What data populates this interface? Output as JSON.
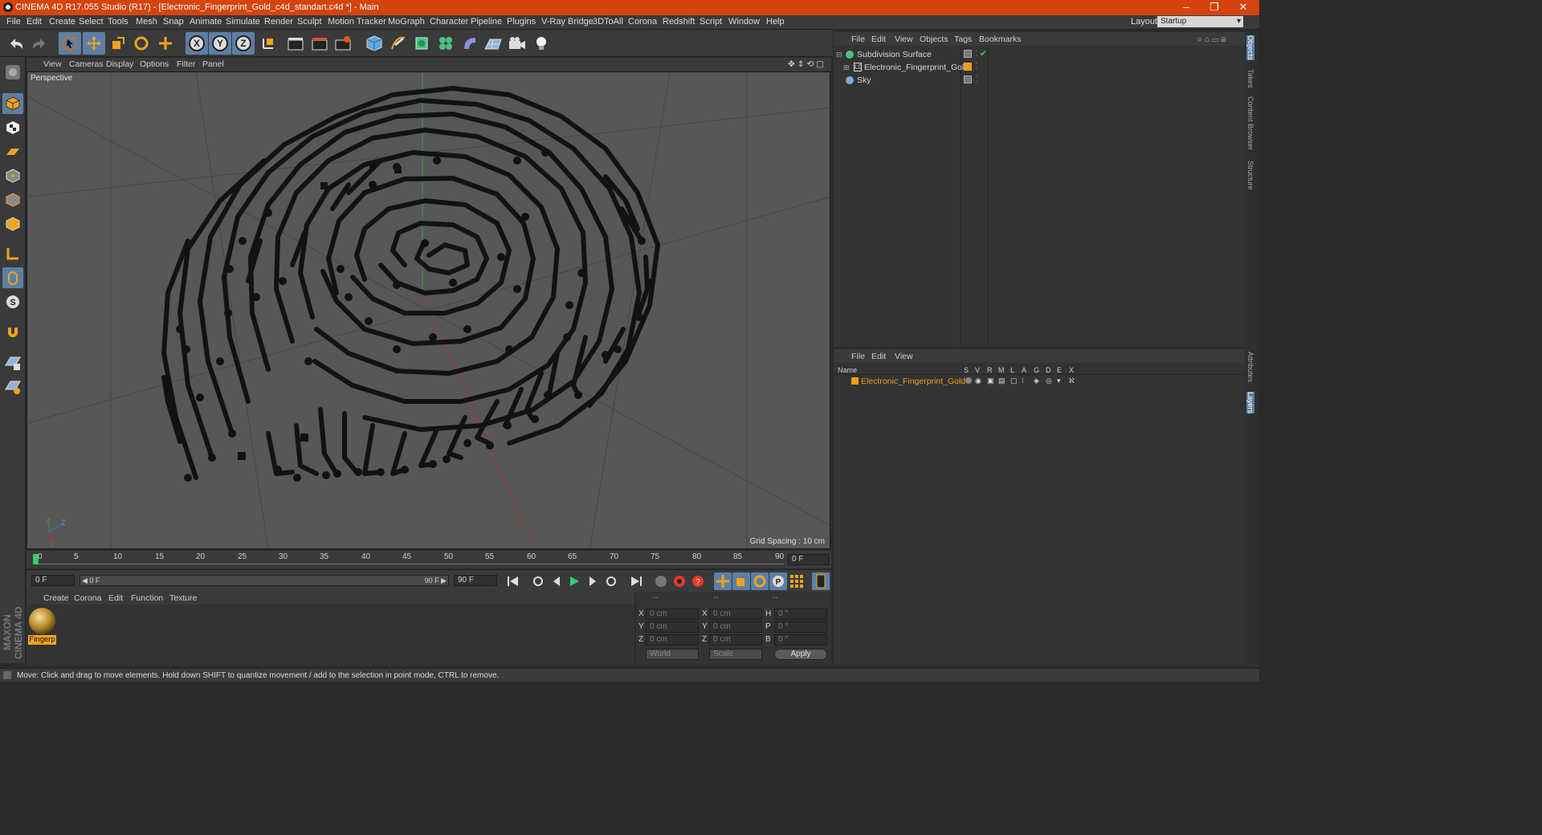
{
  "window": {
    "title": "CINEMA 4D R17.055 Studio (R17) - [Electronic_Fingerprint_Gold_c4d_standart.c4d *] - Main",
    "min": "–",
    "max": "❐",
    "close": "✕"
  },
  "menu": [
    "File",
    "Edit",
    "Create",
    "Select",
    "Tools",
    "Mesh",
    "Snap",
    "Animate",
    "Simulate",
    "Render",
    "Sculpt",
    "Motion Tracker",
    "MoGraph",
    "Character",
    "Pipeline",
    "Plugins",
    "V-Ray Bridge",
    "3DToAll",
    "Corona",
    "Redshift",
    "Script",
    "Window",
    "Help"
  ],
  "layout": {
    "label": "Layout:",
    "value": "Startup"
  },
  "toolbar": {
    "x": "X",
    "y": "Y",
    "z": "Z"
  },
  "viewport": {
    "menu": [
      "View",
      "Cameras",
      "Display",
      "Options",
      "Filter",
      "Panel"
    ],
    "label": "Perspective",
    "grid_spacing": "Grid Spacing : 10 cm"
  },
  "timeline": {
    "ticks": [
      "0",
      "5",
      "10",
      "15",
      "20",
      "25",
      "30",
      "35",
      "40",
      "45",
      "50",
      "55",
      "60",
      "65",
      "70",
      "75",
      "80",
      "85",
      "90"
    ],
    "frame_field": "0 F"
  },
  "transport": {
    "start": "0 F",
    "range_start": "◀ 0 F",
    "range_end": "90 F ▶",
    "end": "90 F"
  },
  "material_panel": {
    "menu": [
      "Create",
      "Corona",
      "Edit",
      "Function",
      "Texture"
    ],
    "materials": [
      {
        "name": "Fingerp"
      }
    ]
  },
  "coords": {
    "headers": [
      "--",
      "--",
      "--"
    ],
    "rows": [
      {
        "a": "X",
        "av": "0 cm",
        "b": "X",
        "bv": "0 cm",
        "c": "H",
        "cv": "0 °"
      },
      {
        "a": "Y",
        "av": "0 cm",
        "b": "Y",
        "bv": "0 cm",
        "c": "P",
        "cv": "0 °"
      },
      {
        "a": "Z",
        "av": "0 cm",
        "b": "Z",
        "bv": "0 cm",
        "c": "B",
        "cv": "0 °"
      }
    ],
    "world": "World",
    "scale": "Scale",
    "apply": "Apply"
  },
  "object_manager": {
    "menu": [
      "File",
      "Edit",
      "View",
      "Objects",
      "Tags",
      "Bookmarks"
    ],
    "objects": [
      {
        "name": "Subdivision Surface"
      },
      {
        "name": "Electronic_Fingerprint_Gold"
      },
      {
        "name": "Sky"
      }
    ]
  },
  "layer_manager": {
    "menu": [
      "File",
      "Edit",
      "View"
    ],
    "col_name": "Name",
    "cols": [
      "S",
      "V",
      "R",
      "M",
      "L",
      "A",
      "G",
      "D",
      "E",
      "X"
    ],
    "layers": [
      {
        "name": "Electronic_Fingerprint_Gold",
        "color": "#e8a117"
      }
    ]
  },
  "right_tabs": [
    "Objects",
    "Takes",
    "Content Browser",
    "Structure",
    "Attributes",
    "Layers"
  ],
  "branding": "MAXON CINEMA 4D",
  "status": "Move: Click and drag to move elements. Hold down SHIFT to quantize movement / add to the selection in point mode, CTRL to remove.",
  "colors": {
    "title_bar": "#d4440c",
    "accent": "#5d7fa6",
    "layer_orange": "#e8a117"
  }
}
